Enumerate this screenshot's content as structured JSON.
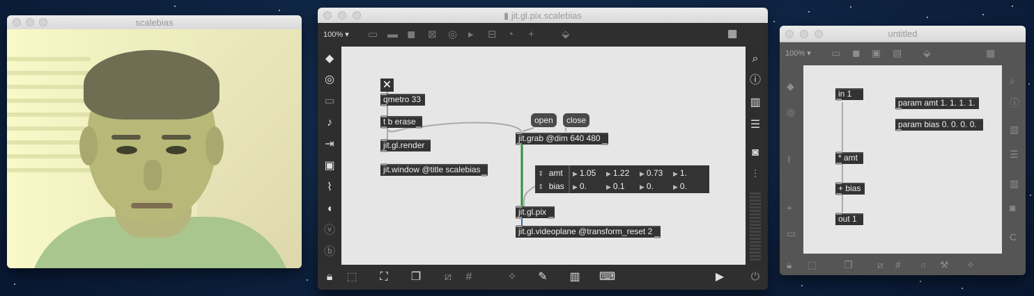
{
  "left_window": {
    "title": "scalebias",
    "content": "webcam-video-frame"
  },
  "mid_window": {
    "title": "jit.gl.pix.scalebias",
    "zoom": "100%",
    "objects": {
      "toggle_glyph": "✕",
      "qmetro": "qmetro 33",
      "t_b_erase": "t b erase",
      "render": "jit.gl.render",
      "window_obj": "jit.window @title scalebias",
      "grab": "jit.grab @dim 640 480",
      "pix": "jit.gl.pix",
      "videoplane": "jit.gl.videoplane @transform_reset 2"
    },
    "messages": {
      "open": "open",
      "close": "close"
    },
    "attrui": [
      {
        "name": "amt",
        "values": [
          "1.05",
          "1.22",
          "0.73",
          "1."
        ]
      },
      {
        "name": "bias",
        "values": [
          "0.",
          "0.1",
          "0.",
          "0."
        ]
      }
    ]
  },
  "right_window": {
    "title": "untitled",
    "zoom": "100%",
    "objects": {
      "in1": "in 1",
      "amt": "* amt",
      "bias": "+ bias",
      "out1": "out 1",
      "param_amt": "param amt 1. 1. 1. 1.",
      "param_bias": "param bias 0. 0. 0. 0."
    }
  }
}
